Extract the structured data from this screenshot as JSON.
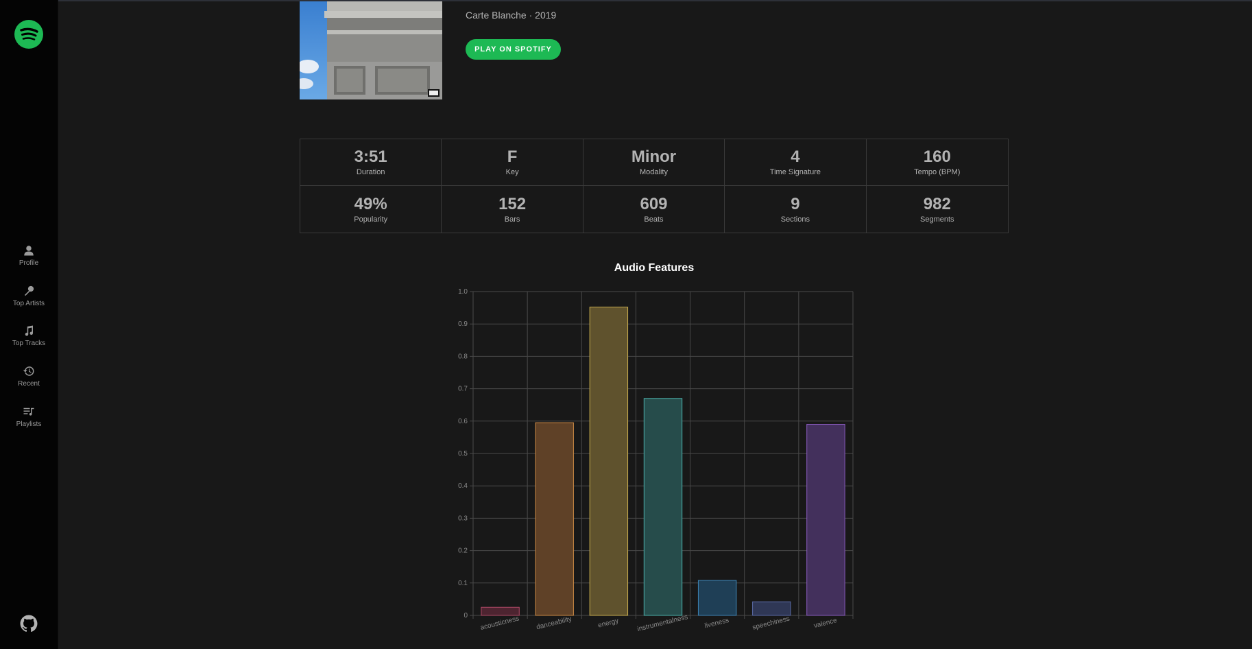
{
  "sidebar": {
    "logo_icon": "spotify-logo-icon",
    "items": [
      {
        "label": "Profile",
        "icon": "user-icon"
      },
      {
        "label": "Top Artists",
        "icon": "microphone-icon"
      },
      {
        "label": "Top Tracks",
        "icon": "music-note-icon"
      },
      {
        "label": "Recent",
        "icon": "history-icon"
      },
      {
        "label": "Playlists",
        "icon": "playlist-icon"
      }
    ],
    "github_icon": "github-icon"
  },
  "track": {
    "album_meta": "Carte Blanche · 2019",
    "play_label": "PLAY ON SPOTIFY"
  },
  "stats": [
    {
      "value": "3:51",
      "label": "Duration"
    },
    {
      "value": "F",
      "label": "Key"
    },
    {
      "value": "Minor",
      "label": "Modality"
    },
    {
      "value": "4",
      "label": "Time Signature"
    },
    {
      "value": "160",
      "label": "Tempo (BPM)"
    },
    {
      "value": "49%",
      "label": "Popularity"
    },
    {
      "value": "152",
      "label": "Bars"
    },
    {
      "value": "609",
      "label": "Beats"
    },
    {
      "value": "9",
      "label": "Sections"
    },
    {
      "value": "982",
      "label": "Segments"
    }
  ],
  "colors": {
    "accent": "#1db954",
    "background": "#181818",
    "sidebar": "#040404"
  },
  "chart_data": {
    "type": "bar",
    "title": "Audio Features",
    "categories": [
      "acousticness",
      "danceability",
      "energy",
      "instrumentalness",
      "liveness",
      "speechiness",
      "valence"
    ],
    "values": [
      0.025,
      0.595,
      0.952,
      0.67,
      0.108,
      0.042,
      0.59
    ],
    "ylim": [
      0,
      1.0
    ],
    "yticks": [
      "0",
      "0.1",
      "0.2",
      "0.3",
      "0.4",
      "0.5",
      "0.6",
      "0.7",
      "0.8",
      "0.9",
      "1.0"
    ],
    "grid": true,
    "bar_colors": [
      {
        "fill": "#4d2430",
        "stroke": "#b04a66"
      },
      {
        "fill": "#5f4127",
        "stroke": "#cc8a45"
      },
      {
        "fill": "#5f522d",
        "stroke": "#c9ad4f"
      },
      {
        "fill": "#264c4b",
        "stroke": "#4bb0ab"
      },
      {
        "fill": "#1f3f56",
        "stroke": "#3f86b8"
      },
      {
        "fill": "#2f3755",
        "stroke": "#5a6aa6"
      },
      {
        "fill": "#43305c",
        "stroke": "#8a5cc0"
      }
    ]
  }
}
